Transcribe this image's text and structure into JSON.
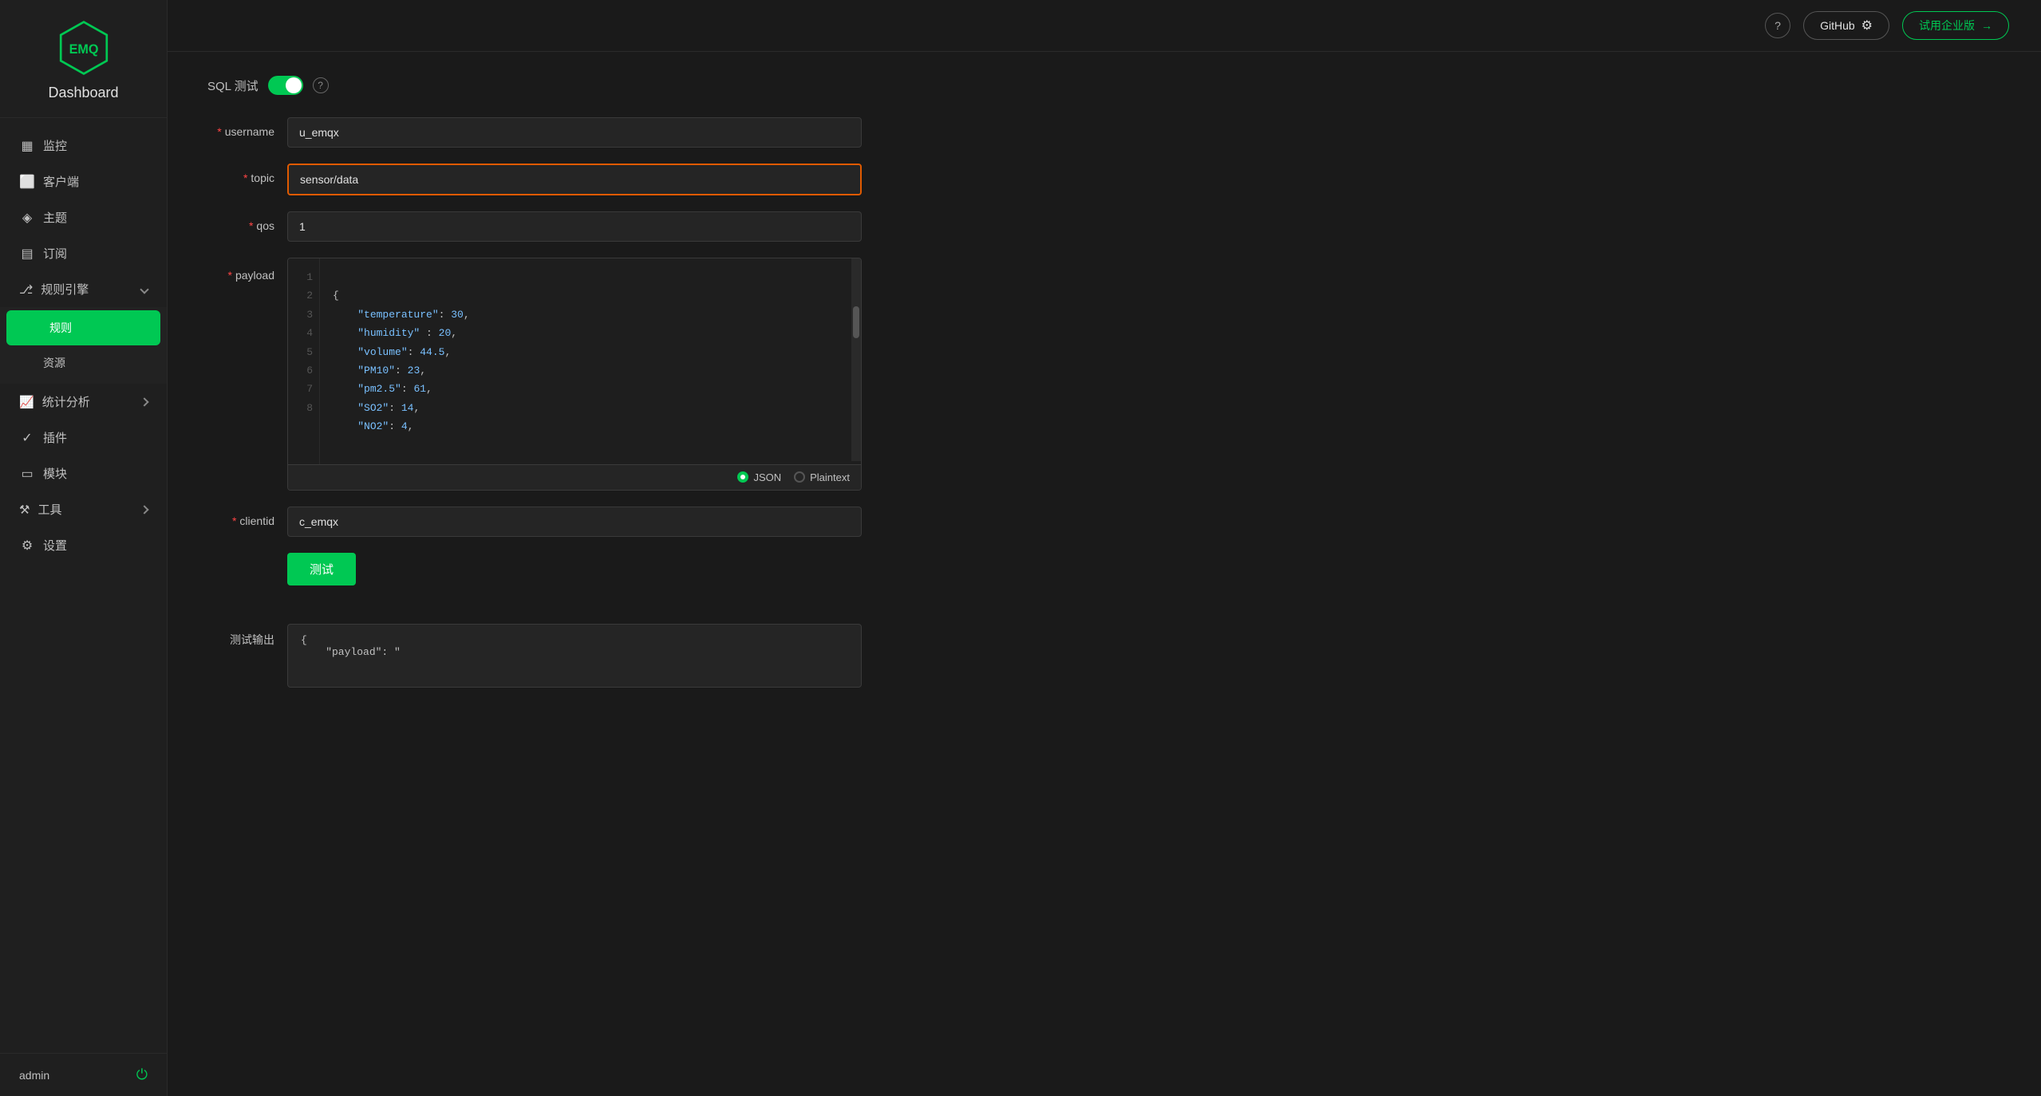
{
  "app": {
    "title": "Dashboard"
  },
  "topbar": {
    "help_title": "?",
    "github_label": "GitHub",
    "trial_label": "试用企业版",
    "trial_arrow": "→"
  },
  "sidebar": {
    "logo_text": "EMQ",
    "dashboard_label": "Dashboard",
    "items": [
      {
        "id": "monitor",
        "label": "监控",
        "icon": "▦"
      },
      {
        "id": "clients",
        "label": "客户端",
        "icon": "⬜"
      },
      {
        "id": "topics",
        "label": "主题",
        "icon": "◈"
      },
      {
        "id": "subscriptions",
        "label": "订阅",
        "icon": "▤"
      },
      {
        "id": "rule-engine",
        "label": "规则引擎",
        "icon": "⎇",
        "expandable": true,
        "expanded": true
      },
      {
        "id": "rules",
        "label": "规则",
        "active": true
      },
      {
        "id": "resources",
        "label": "资源"
      },
      {
        "id": "stats",
        "label": "统计分析",
        "icon": "📈",
        "expandable": true
      },
      {
        "id": "plugins",
        "label": "插件",
        "icon": "✓"
      },
      {
        "id": "modules",
        "label": "模块",
        "icon": "▭"
      },
      {
        "id": "tools",
        "label": "工具",
        "icon": "⚒",
        "expandable": true
      },
      {
        "id": "settings",
        "label": "设置",
        "icon": "⚙"
      }
    ],
    "user_label": "admin",
    "logout_icon": "⏻"
  },
  "form": {
    "sql_test_label": "SQL 测试",
    "username_label": "username",
    "username_required": "*",
    "username_value": "u_emqx",
    "topic_label": "topic",
    "topic_required": "*",
    "topic_value": "sensor/data",
    "qos_label": "qos",
    "qos_required": "*",
    "qos_value": "1",
    "payload_label": "payload",
    "payload_required": "*",
    "payload_lines": [
      {
        "num": "1",
        "content": "{"
      },
      {
        "num": "2",
        "content": "    \"temperature\": 30,"
      },
      {
        "num": "3",
        "content": "    \"humidity\" : 20,"
      },
      {
        "num": "4",
        "content": "    \"volume\": 44.5,"
      },
      {
        "num": "5",
        "content": "    \"PM10\": 23,"
      },
      {
        "num": "6",
        "content": "    \"pm2.5\": 61,"
      },
      {
        "num": "7",
        "content": "    \"SO2\": 14,"
      },
      {
        "num": "8",
        "content": "    \"NO2\": 4,"
      }
    ],
    "format_json": "JSON",
    "format_plaintext": "Plaintext",
    "clientid_label": "clientid",
    "clientid_required": "*",
    "clientid_value": "c_emqx",
    "test_button_label": "测试",
    "output_label": "测试输出",
    "output_content": "{\n    \"payload\": \""
  }
}
